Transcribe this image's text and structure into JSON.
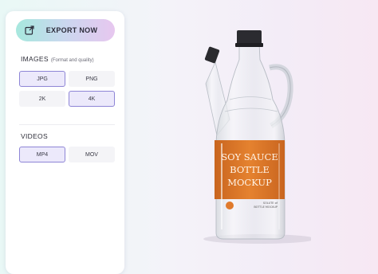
{
  "export": {
    "label": "EXPORT NOW",
    "icon": "external-link-icon"
  },
  "images": {
    "title": "IMAGES",
    "subtitle": "(Format and quality)",
    "options": [
      {
        "label": "JPG",
        "selected": true
      },
      {
        "label": "PNG",
        "selected": false
      },
      {
        "label": "2K",
        "selected": false
      },
      {
        "label": "4K",
        "selected": true
      }
    ]
  },
  "videos": {
    "title": "VIDEOS",
    "options": [
      {
        "label": "MP4",
        "selected": true
      },
      {
        "label": "MOV",
        "selected": false
      }
    ]
  },
  "product": {
    "label_line1": "SOY SAUCE",
    "label_line2": "BOTTLE",
    "label_line3": "MOCKUP",
    "fine_print_1": "SOLUTE of",
    "fine_print_2": "BOTTLE MOCKUP"
  },
  "colors": {
    "accent": "#8e85d6",
    "label_orange": "#e07a2c",
    "export_gradient_start": "#a7e8de",
    "export_gradient_end": "#e7c7ef"
  }
}
